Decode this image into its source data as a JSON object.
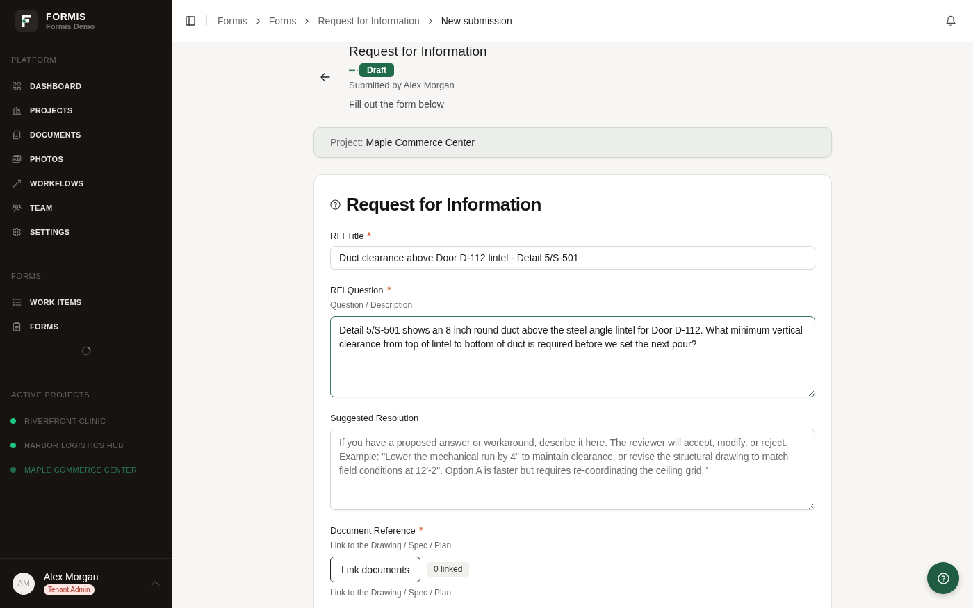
{
  "sidebar": {
    "brand": {
      "name": "FORMIS",
      "workspace": "Formis Demo"
    },
    "sections": [
      {
        "title": "PLATFORM",
        "items": [
          {
            "label": "DASHBOARD",
            "selected": false
          },
          {
            "label": "PROJECTS",
            "selected": false
          },
          {
            "label": "DOCUMENTS",
            "selected": false
          },
          {
            "label": "PHOTOS",
            "selected": false
          },
          {
            "label": "WORKFLOWS",
            "selected": false
          },
          {
            "label": "TEAM",
            "selected": false
          },
          {
            "label": "SETTINGS",
            "selected": false
          }
        ]
      },
      {
        "title": "FORMS",
        "loading": true,
        "items": [
          {
            "label": "WORK ITEMS",
            "selected": false
          },
          {
            "label": "FORMS",
            "selected": false
          }
        ]
      }
    ],
    "active_projects": {
      "title": "ACTIVE PROJECTS",
      "items": [
        {
          "label": "RIVERFRONT CLINIC",
          "color": "#1fc583",
          "selected": false
        },
        {
          "label": "HARBOR LOGISTICS HUB",
          "color": "#1fc583",
          "selected": false
        },
        {
          "label": "MAPLE COMMERCE CENTER",
          "color": "#23694a",
          "selected": true
        }
      ]
    },
    "user": {
      "initials": "AM",
      "name": "Alex Morgan",
      "role": "Tenant Admin"
    }
  },
  "header": {
    "breadcrumbs": [
      {
        "label": "Formis",
        "current": false
      },
      {
        "label": "Forms",
        "current": false
      },
      {
        "label": "Request for Information",
        "current": false
      },
      {
        "label": "New submission",
        "current": true
      }
    ]
  },
  "page": {
    "title": "Request for Information",
    "status": "Draft",
    "submitted_by": "Submitted by Alex Morgan",
    "subtitle": "Fill out the form below"
  },
  "project": {
    "label": "Project:",
    "name": "Maple Commerce Center"
  },
  "form": {
    "title": "Request for Information",
    "fields": [
      {
        "kind": "text",
        "label": "RFI Title",
        "required": true,
        "focused": false,
        "value": "Duct clearance above Door D-112 lintel - Detail 5/S-501"
      },
      {
        "kind": "textarea",
        "label": "RFI Question",
        "required": true,
        "hint": "Question / Description",
        "focused": true,
        "value": "Detail 5/S-501 shows an 8 inch round duct above the steel angle lintel for Door D-112. What minimum vertical clearance from top of lintel to bottom of duct is required before we set the next pour?"
      },
      {
        "kind": "textarea",
        "label": "Suggested Resolution",
        "required": false,
        "focused": false,
        "placeholder": "If you have a proposed answer or workaround, describe it here. The reviewer will accept, modify, or reject. Example: \"Lower the mechanical run by 4\" to maintain clearance, or revise the structural drawing to match field conditions at 12'-2\". Option A is faster but requires re-coordinating the ceiling grid.\""
      },
      {
        "kind": "documents",
        "label": "Document Reference",
        "required": true,
        "hint": "Link to the Drawing / Spec / Plan",
        "button": "Link documents",
        "count": "0 linked",
        "footer": "Link to the Drawing / Spec / Plan"
      }
    ]
  }
}
